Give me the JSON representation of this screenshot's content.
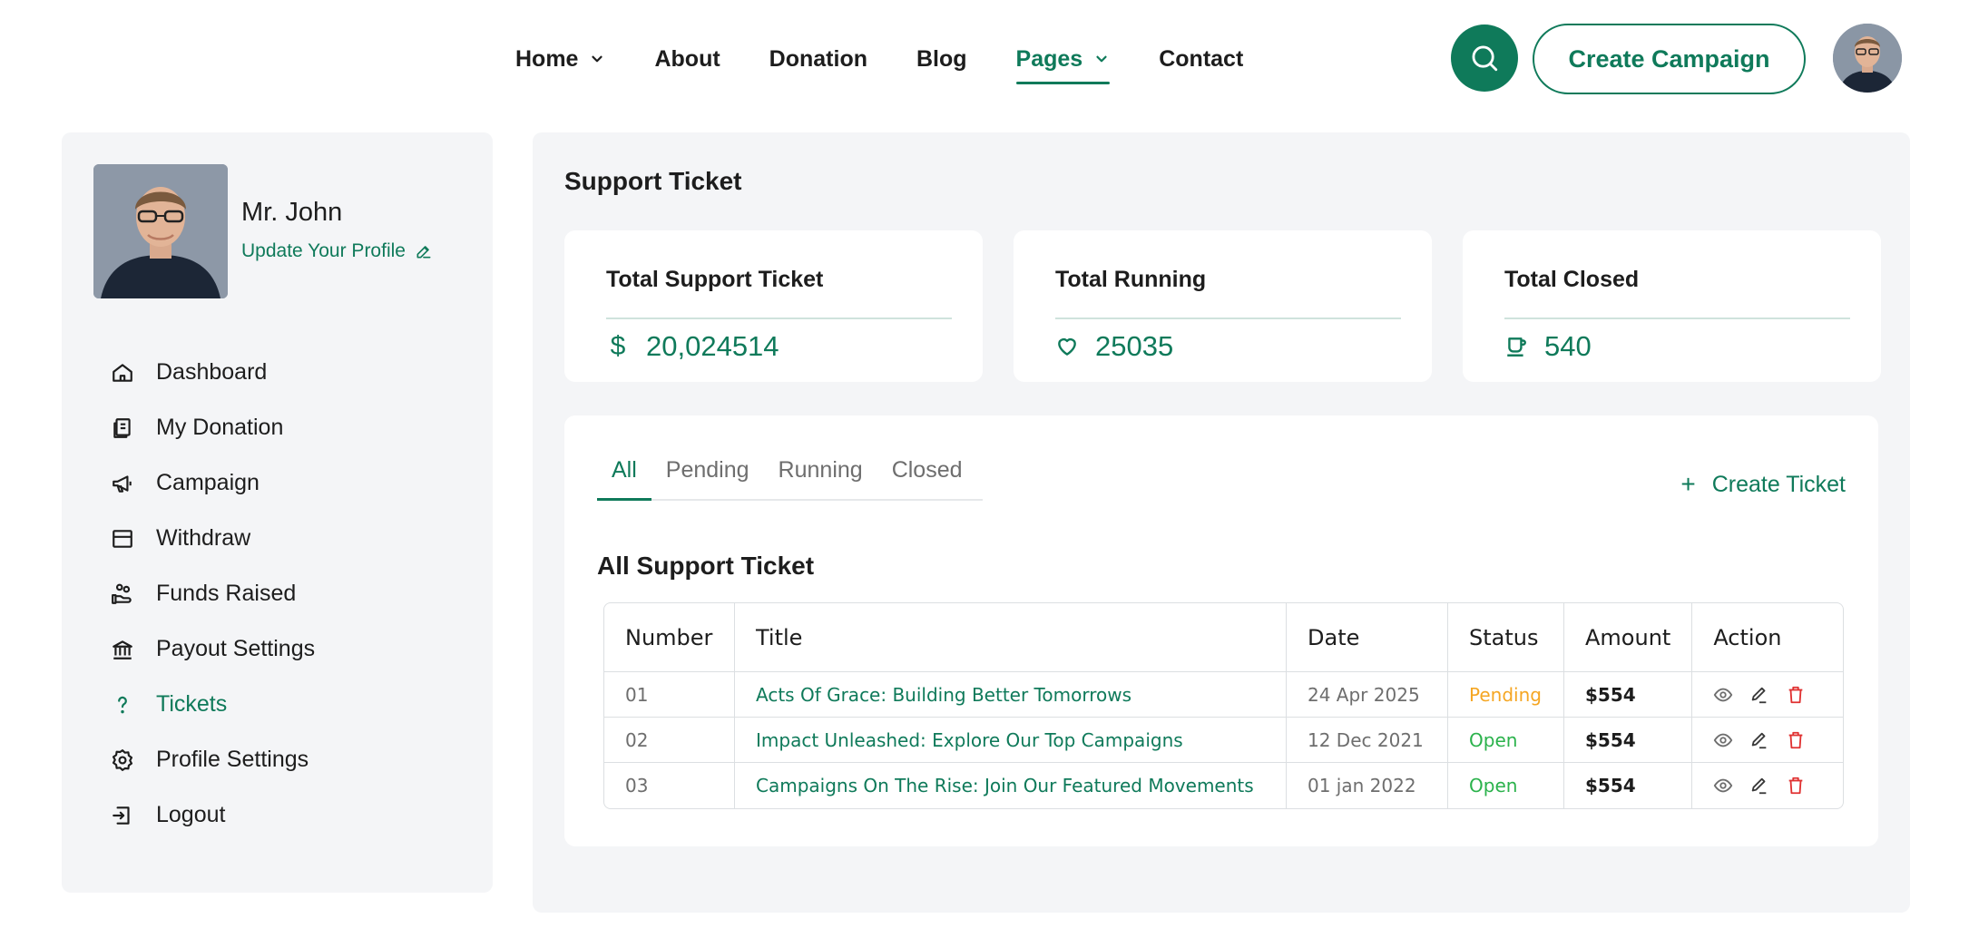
{
  "nav": {
    "items": [
      {
        "label": "Home",
        "dropdown": true,
        "active": false
      },
      {
        "label": "About",
        "dropdown": false,
        "active": false
      },
      {
        "label": "Donation",
        "dropdown": false,
        "active": false
      },
      {
        "label": "Blog",
        "dropdown": false,
        "active": false
      },
      {
        "label": "Pages",
        "dropdown": true,
        "active": true
      },
      {
        "label": "Contact",
        "dropdown": false,
        "active": false
      }
    ],
    "search_icon": "search-icon",
    "create_campaign_label": "Create Campaign"
  },
  "profile": {
    "name": "Mr. John",
    "update_label": "Update Your Profile"
  },
  "sidebar": {
    "items": [
      {
        "label": "Dashboard",
        "icon": "home-icon"
      },
      {
        "label": "My Donation",
        "icon": "donation-icon"
      },
      {
        "label": "Campaign",
        "icon": "megaphone-icon"
      },
      {
        "label": "Withdraw",
        "icon": "wallet-icon"
      },
      {
        "label": "Funds Raised",
        "icon": "hand-coins-icon"
      },
      {
        "label": "Payout Settings",
        "icon": "bank-icon"
      },
      {
        "label": "Tickets",
        "icon": "question-icon",
        "active": true
      },
      {
        "label": "Profile Settings",
        "icon": "settings-icon"
      },
      {
        "label": "Logout",
        "icon": "logout-icon"
      }
    ]
  },
  "main": {
    "title": "Support Ticket",
    "stats": [
      {
        "label": "Total Support Ticket",
        "symbol": "$",
        "value": "20,024514"
      },
      {
        "label": "Total Running",
        "icon": "heart-icon",
        "value": "25035"
      },
      {
        "label": "Total Closed",
        "icon": "cup-icon",
        "value": "540"
      }
    ],
    "tabs": [
      "All",
      "Pending",
      "Running",
      "Closed"
    ],
    "active_tab": "All",
    "create_ticket_label": "Create Ticket",
    "table_title": "All Support Ticket",
    "table": {
      "headers": [
        "Number",
        "Title",
        "Date",
        "Status",
        "Amount",
        "Action"
      ],
      "rows": [
        {
          "number": "01",
          "title": "Acts Of Grace: Building Better Tomorrows",
          "date": "24 Apr 2025",
          "status": "Pending",
          "amount": "$554"
        },
        {
          "number": "02",
          "title": "Impact Unleashed: Explore Our Top Campaigns",
          "date": "12 Dec 2021",
          "status": "Open",
          "amount": "$554"
        },
        {
          "number": "03",
          "title": "Campaigns On The Rise: Join Our Featured Movements",
          "date": "01 jan 2022",
          "status": "Open",
          "amount": "$554"
        }
      ]
    }
  },
  "colors": {
    "accent": "#0f7a5a",
    "pending": "#f5a623",
    "open": "#2bb24c",
    "delete": "#e03131",
    "panel_bg": "#f4f5f7"
  }
}
